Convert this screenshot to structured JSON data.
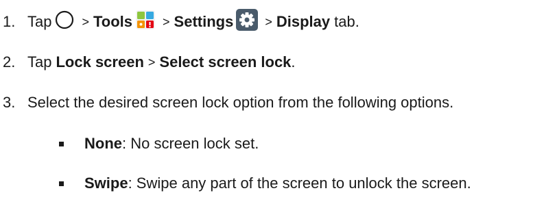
{
  "steps": [
    {
      "num": "1.",
      "tap": "Tap",
      "gt1": ">",
      "tools": "Tools",
      "gt2": ">",
      "settings": "Settings",
      "gt3": ">",
      "display": "Display",
      "tab": "tab."
    },
    {
      "num": "2.",
      "tap": "Tap",
      "lock_screen": "Lock screen",
      "gt": ">",
      "select_lock": "Select screen lock",
      "period": "."
    },
    {
      "num": "3.",
      "text": "Select the desired screen lock option from the following options."
    }
  ],
  "options": [
    {
      "name": "None",
      "desc": ": No screen lock set."
    },
    {
      "name": "Swipe",
      "desc": ": Swipe any part of the screen to unlock the screen."
    }
  ],
  "icons": {
    "home": "home-circle-icon",
    "tools": "tools-folder-icon",
    "settings": "gear-icon"
  },
  "colors": {
    "text": "#1a1a1a",
    "settings_icon_bg": "#4a5b6b",
    "tools_green": "#8ec63f",
    "tools_blue": "#36a9e1",
    "tools_orange": "#f39200",
    "tools_red": "#e30613"
  }
}
